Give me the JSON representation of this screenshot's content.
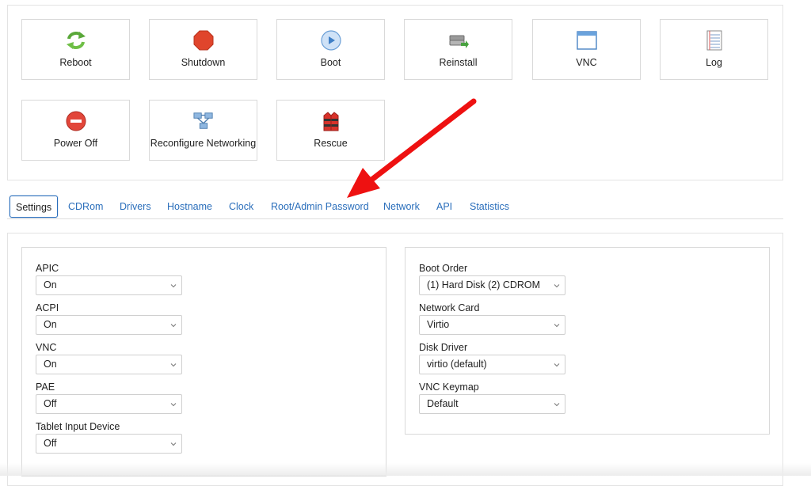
{
  "actions": {
    "reboot": {
      "label": "Reboot",
      "icon": "reboot-icon"
    },
    "shutdown": {
      "label": "Shutdown",
      "icon": "shutdown-icon"
    },
    "boot": {
      "label": "Boot",
      "icon": "boot-icon"
    },
    "reinstall": {
      "label": "Reinstall",
      "icon": "reinstall-icon"
    },
    "vnc": {
      "label": "VNC",
      "icon": "vnc-window-icon"
    },
    "log": {
      "label": "Log",
      "icon": "log-icon"
    },
    "power_off": {
      "label": "Power Off",
      "icon": "power-off-icon"
    },
    "reconfigure_networking": {
      "label": "Reconfigure Networking",
      "icon": "network-icon"
    },
    "rescue": {
      "label": "Rescue",
      "icon": "rescue-vest-icon"
    }
  },
  "tabs": [
    "Settings",
    "CDRom",
    "Drivers",
    "Hostname",
    "Clock",
    "Root/Admin Password",
    "Network",
    "API",
    "Statistics"
  ],
  "active_tab": "Settings",
  "settings": {
    "left": [
      {
        "label": "APIC",
        "value": "On"
      },
      {
        "label": "ACPI",
        "value": "On"
      },
      {
        "label": "VNC",
        "value": "On"
      },
      {
        "label": "PAE",
        "value": "Off"
      },
      {
        "label": "Tablet Input Device",
        "value": "Off"
      }
    ],
    "right": [
      {
        "label": "Boot Order",
        "value": "(1) Hard Disk (2) CDROM"
      },
      {
        "label": "Network Card",
        "value": "Virtio"
      },
      {
        "label": "Disk Driver",
        "value": "virtio (default)"
      },
      {
        "label": "VNC Keymap",
        "value": "Default"
      }
    ]
  },
  "colors": {
    "link": "#2a6ebb",
    "annotation_arrow": "#ee1111",
    "border": "#d9d9d9"
  }
}
